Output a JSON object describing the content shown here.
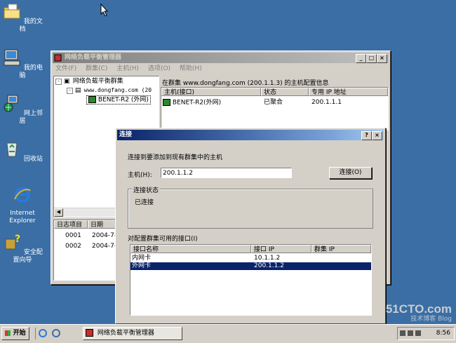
{
  "desktop": {
    "icons": [
      {
        "label": "我的文档",
        "icon": "folder-documents-icon"
      },
      {
        "label": "我的电脑",
        "icon": "computer-icon"
      },
      {
        "label": "网上邻居",
        "icon": "network-icon"
      },
      {
        "label": "回收站",
        "icon": "recycle-bin-icon"
      },
      {
        "label": "Internet\nExplorer",
        "icon": "ie-icon"
      },
      {
        "label": "安全配置向导",
        "icon": "security-wizard-icon"
      }
    ]
  },
  "main_window": {
    "title": "网络负载平衡管理器",
    "menu": [
      "文件(F)",
      "群集(C)",
      "主机(H)",
      "选项(O)",
      "帮助(H)"
    ],
    "tree": {
      "root": "网络负载平衡群集",
      "cluster": "www.dongfang.com (20",
      "host": "BENET-R2 (外网)"
    },
    "info_header": "在群集 www.dongfang.com (200.1.1.3) 的主机配置信息",
    "host_columns": [
      "主机(接口)",
      "状态",
      "专用 IP 地址"
    ],
    "host_rows": [
      {
        "host": "BENET-R2(外网)",
        "status": "已聚合",
        "ip": "200.1.1.1"
      }
    ],
    "log_columns": [
      "日志项目",
      "日期"
    ],
    "log_rows": [
      {
        "id": "0001",
        "date": "2004-7-"
      },
      {
        "id": "0002",
        "date": "2004-7-"
      }
    ]
  },
  "dialog": {
    "title": "连接",
    "instruction": "连接到要添加到现有群集中的主机",
    "host_label": "主机(H):",
    "host_value": "200.1.1.2",
    "connect_button": "连接(O)",
    "status_group": "连接状态",
    "status_text": "已连接",
    "interfaces_label": "对配置群集可用的接口(I)",
    "interface_columns": [
      "接口名称",
      "接口 IP",
      "群集 IP"
    ],
    "interfaces": [
      {
        "name": "内网卡",
        "ip": "10.1.1.2",
        "cluster_ip": "",
        "selected": false
      },
      {
        "name": "外网卡",
        "ip": "200.1.1.2",
        "cluster_ip": "",
        "selected": true
      }
    ]
  },
  "taskbar": {
    "start_label": "开始",
    "task_label": "网络负载平衡管理器",
    "clock": "8:56"
  },
  "watermark": {
    "site": "51CTO.com",
    "sub": "技术博客 Blog"
  },
  "colors": {
    "desktop": "#3a6ea5",
    "title_active": "#0a246a",
    "title_inactive": "#808080",
    "selection": "#0a246a"
  }
}
